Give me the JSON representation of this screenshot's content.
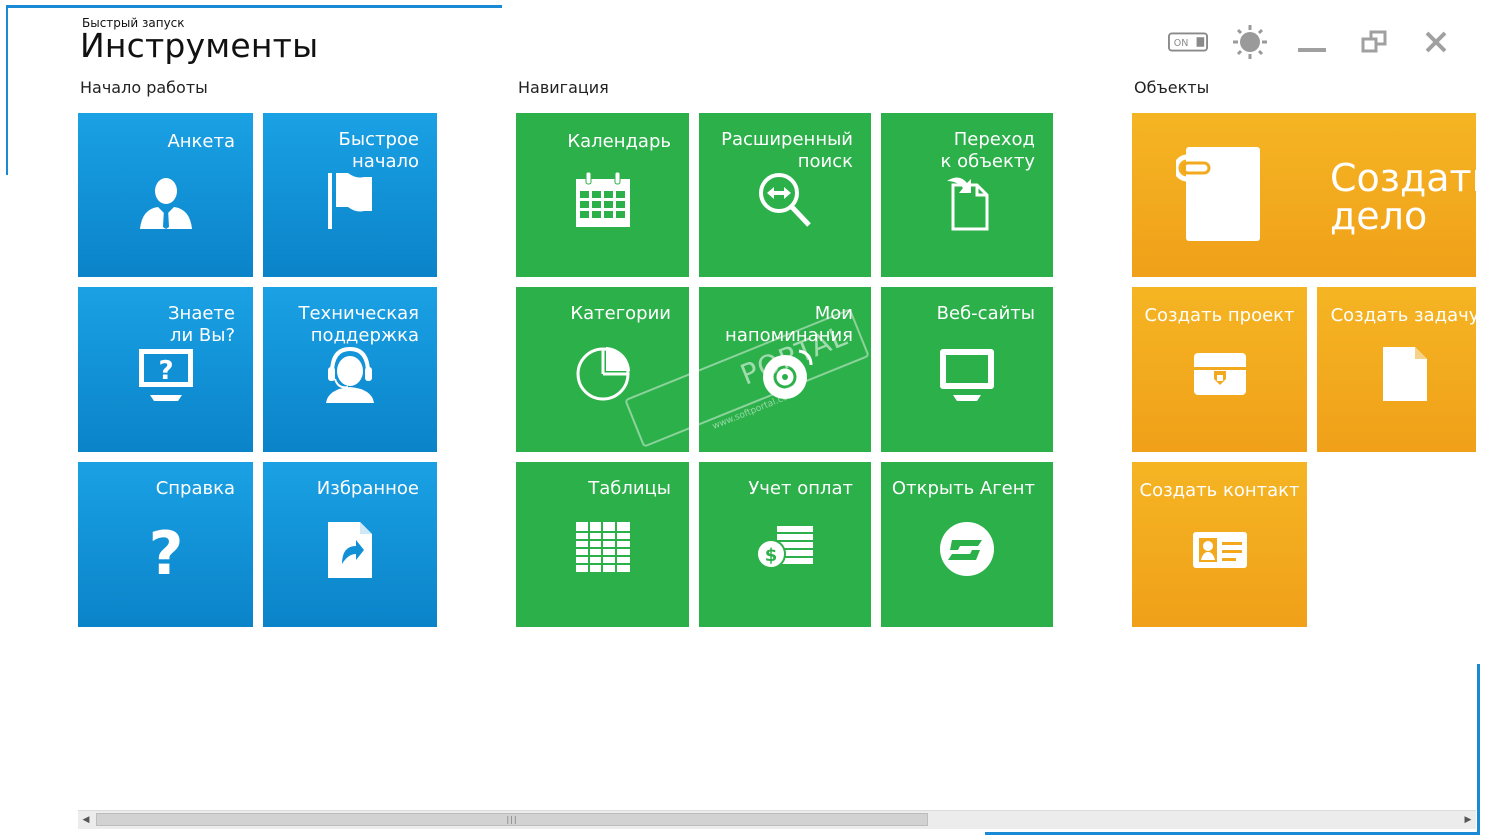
{
  "header": {
    "subtitle": "Быстрый запуск",
    "title": "Инструменты",
    "toggle_label": "ON"
  },
  "groups": {
    "start": {
      "label": "Начало работы",
      "tiles": {
        "anketa": "Анкета",
        "quick_start": "Быстрое\nначало",
        "did_you_know": "Знаете\nли Вы?",
        "support": "Техническая\nподдержка",
        "help": "Справка",
        "favorites": "Избранное"
      }
    },
    "navigation": {
      "label": "Навигация",
      "tiles": {
        "calendar": "Календарь",
        "advanced_search": "Расширенный\nпоиск",
        "go_to_object": "Переход\nк объекту",
        "categories": "Категории",
        "reminders": "Мои\nнапоминания",
        "websites": "Веб-сайты",
        "tables": "Таблицы",
        "payments": "Учет оплат",
        "open_agent": "Открыть Агент"
      }
    },
    "objects": {
      "label": "Объекты",
      "tiles": {
        "create_case": "Создать\nдело",
        "create_project": "Создать проект",
        "create_task": "Создать задачу",
        "create_contact": "Создать контакт"
      }
    }
  },
  "watermark": {
    "brand": "PORTAL",
    "url": "www.softportal.com"
  },
  "colors": {
    "blue": "#1296d9",
    "green": "#2cb04a",
    "orange": "#f2a91e",
    "frame": "#1a8ad4"
  },
  "icons": [
    "user-icon",
    "flag-icon",
    "question-monitor-icon",
    "headset-icon",
    "question-icon",
    "favorite-doc-icon",
    "calendar-icon",
    "search-icon",
    "document-arrow-icon",
    "pie-chart-icon",
    "alarm-icon",
    "monitor-icon",
    "table-icon",
    "coins-icon",
    "agent-icon",
    "folder-clip-icon",
    "briefcase-icon",
    "document-icon",
    "contact-card-icon"
  ]
}
